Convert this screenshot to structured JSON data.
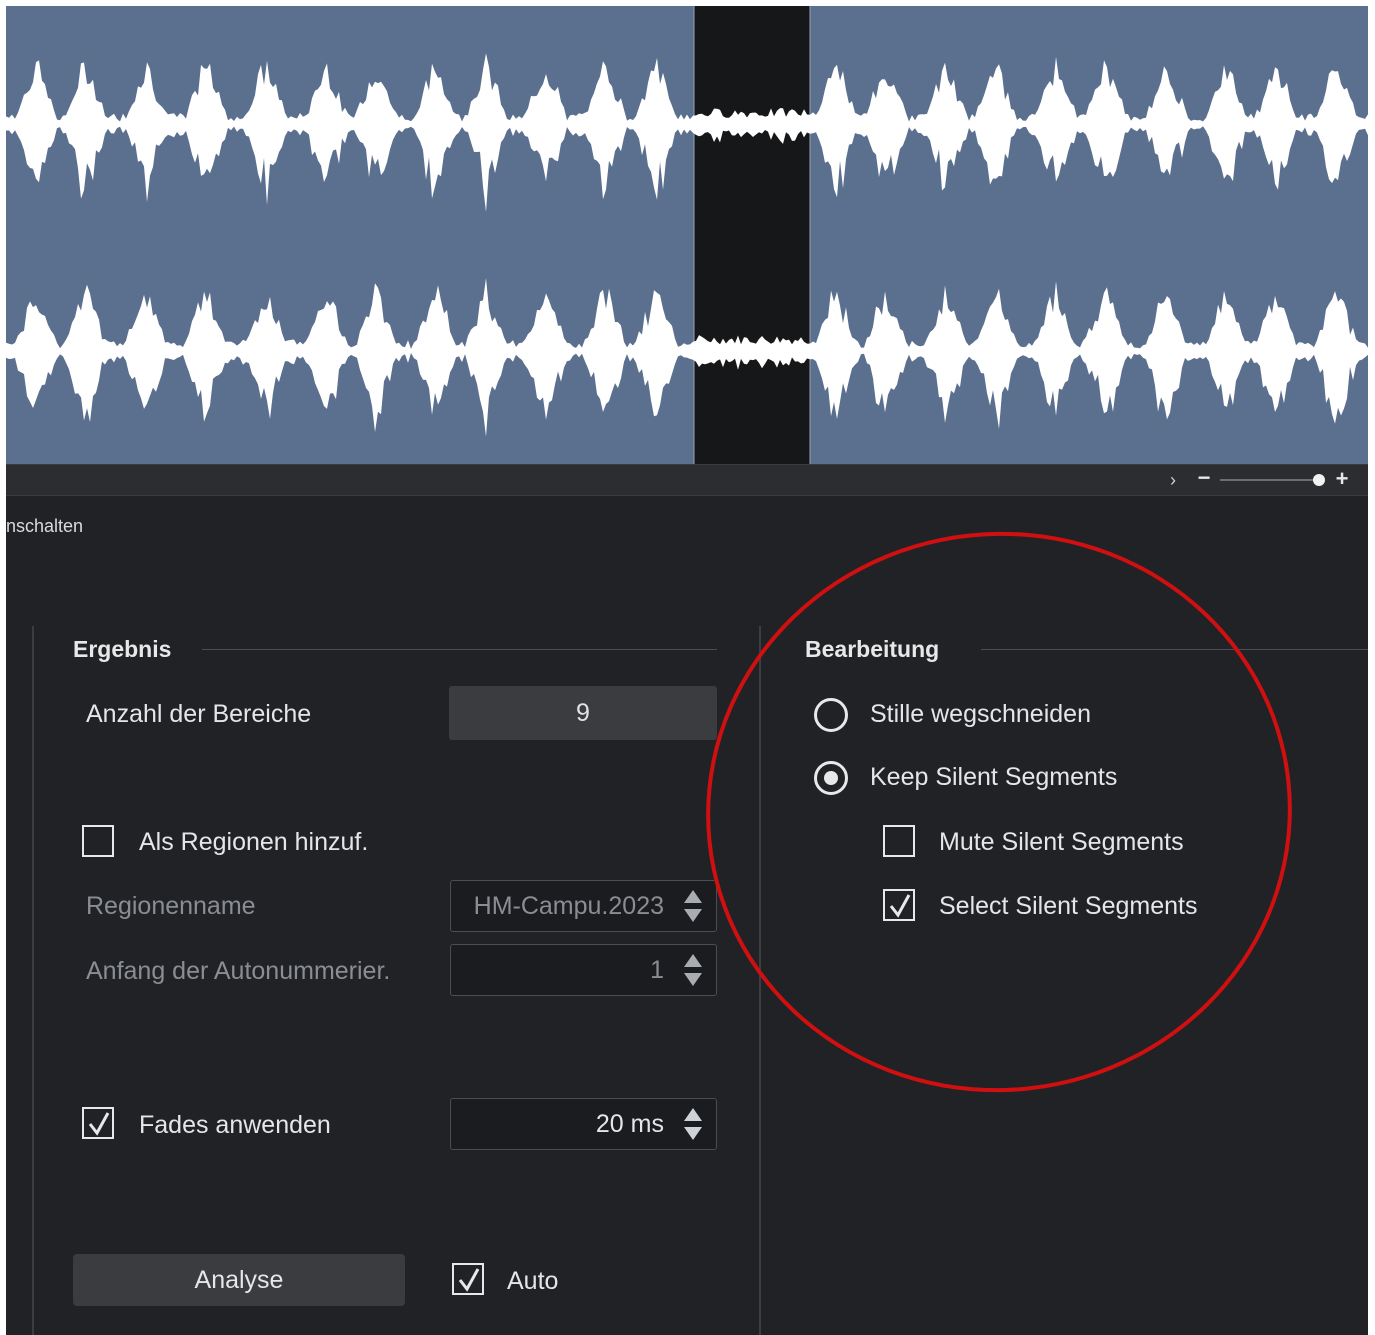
{
  "colors": {
    "waveform_bg": "#5b6f8f",
    "waveform_fill": "#ffffff",
    "selection_bg": "#161719",
    "panel_bg": "#202226",
    "annotation": "#d01010"
  },
  "toolbar": {
    "scroll_arrow": "›",
    "zoom_minus": "−",
    "zoom_plus": "+",
    "zoom_level": 0.95
  },
  "panel": {
    "section_tab": "nschalten"
  },
  "result": {
    "title": "Ergebnis",
    "count_label": "Anzahl der Bereiche",
    "count_value": "9",
    "add_regions_label": "Als Regionen hinzuf.",
    "add_regions_checked": false,
    "region_name_label": "Regionenname",
    "region_name_value": "HM-Campu.2023",
    "autonumber_label": "Anfang der Autonummerier.",
    "autonumber_value": "1",
    "fades_label": "Fades anwenden",
    "fades_checked": true,
    "fades_value": "20 ms",
    "analyse_button": "Analyse",
    "auto_label": "Auto",
    "auto_checked": true
  },
  "edit": {
    "title": "Bearbeitung",
    "option_cut": "Stille wegschneiden",
    "option_keep": "Keep Silent Segments",
    "selected_option": "keep",
    "mute_label": "Mute Silent Segments",
    "mute_checked": false,
    "select_label": "Select Silent Segments",
    "select_checked": true
  }
}
